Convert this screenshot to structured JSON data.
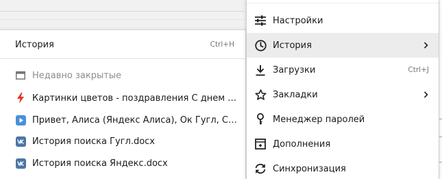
{
  "history_submenu": {
    "header": {
      "label": "История",
      "shortcut": "Ctrl+H"
    },
    "recently_closed": {
      "label": "Недавно закрытые"
    },
    "items": [
      {
        "label": "Картинки цветов - поздравления С днем ро...",
        "icon": "lightning-icon"
      },
      {
        "label": "Привет, Алиса (Яндекс Алиса), Ок Гугл, Сири...",
        "icon": "play-icon"
      },
      {
        "label": "История поиска Гугл.docx",
        "icon": "vk-icon"
      },
      {
        "label": "История поиска Яндекс.docx",
        "icon": "vk-icon"
      }
    ]
  },
  "main_menu": {
    "items": [
      {
        "label": "Настройки",
        "icon": "settings-sliders-icon"
      },
      {
        "label": "История",
        "icon": "clock-icon",
        "has_submenu": true,
        "active": true
      },
      {
        "label": "Загрузки",
        "icon": "download-icon",
        "shortcut": "Ctrl+J"
      },
      {
        "label": "Закладки",
        "icon": "star-icon",
        "has_submenu": true
      },
      {
        "label": "Менеджер паролей",
        "icon": "key-icon"
      },
      {
        "label": "Дополнения",
        "icon": "extensions-icon"
      },
      {
        "label": "Синхронизация",
        "icon": "sync-icon"
      }
    ]
  },
  "colors": {
    "lightning": "#e8322b",
    "play_badge": "#4a90d9",
    "vk_badge": "#4a76a8",
    "active_row": "#ececec"
  }
}
